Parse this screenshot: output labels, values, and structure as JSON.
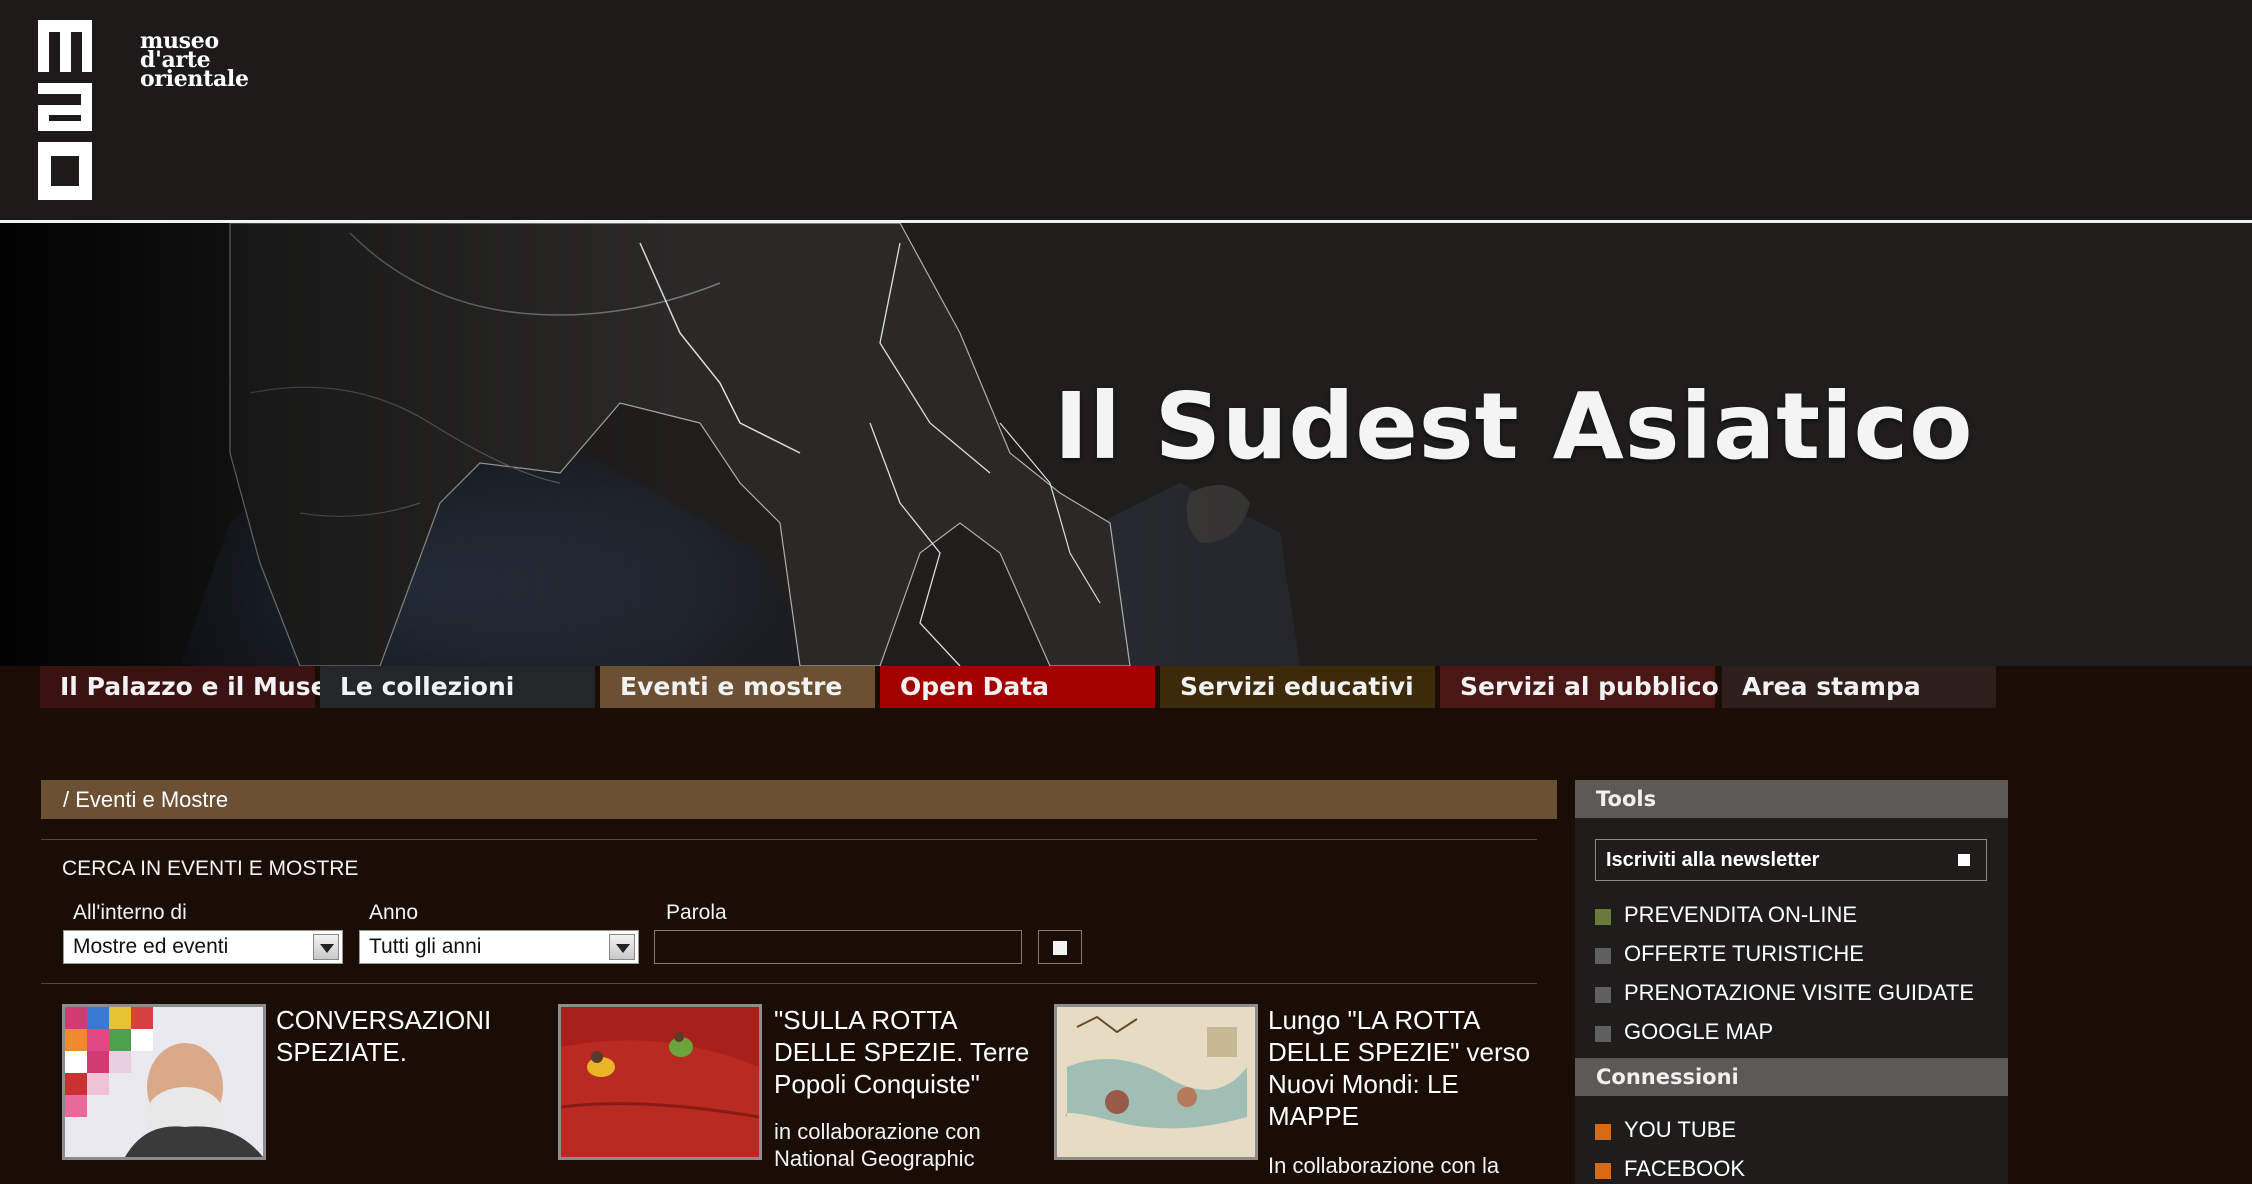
{
  "logo": {
    "line1": "museo",
    "line2": "d'arte",
    "line3": "orientale",
    "mark": "mao"
  },
  "banner": {
    "title": "Il Sudest Asiatico"
  },
  "nav": [
    {
      "label": "Il Palazzo e il Museo",
      "color": "#3a1212"
    },
    {
      "label": "Le collezioni",
      "color": "#232729"
    },
    {
      "label": "Eventi e mostre",
      "color": "#6c5034"
    },
    {
      "label": "Open Data",
      "color": "#a30000"
    },
    {
      "label": "Servizi educativi",
      "color": "#3c2a0a"
    },
    {
      "label": "Servizi al pubblico",
      "color": "#4a1717"
    },
    {
      "label": "Area stampa",
      "color": "#2e1e1c"
    }
  ],
  "breadcrumb": "/ Eventi e Mostre",
  "search": {
    "title": "CERCA IN EVENTI E MOSTRE",
    "within_label": "All'interno di",
    "within_value": "Mostre ed eventi",
    "year_label": "Anno",
    "year_value": "Tutti gli anni",
    "word_label": "Parola",
    "word_value": ""
  },
  "cards": [
    {
      "title": "CONVERSAZIONI SPEZIATE.",
      "desc": ""
    },
    {
      "title": "\"SULLA ROTTA DELLE SPEZIE. Terre Popoli Conquiste\"",
      "desc": "in collaborazione con National Geographic"
    },
    {
      "title": "Lungo \"LA ROTTA DELLE SPEZIE\" verso Nuovi Mondi: LE MAPPE",
      "desc": "In collaborazione con la"
    }
  ],
  "sidebar": {
    "tools_title": "Tools",
    "newsletter": "Iscriviti alla newsletter",
    "tools": [
      {
        "label": "PREVENDITA ON-LINE",
        "color": "#6b7a3a"
      },
      {
        "label": "OFFERTE TURISTICHE",
        "color": "#5f5f5f"
      },
      {
        "label": "PRENOTAZIONE VISITE GUIDATE",
        "color": "#5f5f5f"
      },
      {
        "label": "GOOGLE MAP",
        "color": "#5f5f5f"
      }
    ],
    "connections_title": "Connessioni",
    "connections": [
      {
        "label": "YOU TUBE",
        "color": "#d86a14"
      },
      {
        "label": "FACEBOOK",
        "color": "#d86a14"
      }
    ]
  }
}
